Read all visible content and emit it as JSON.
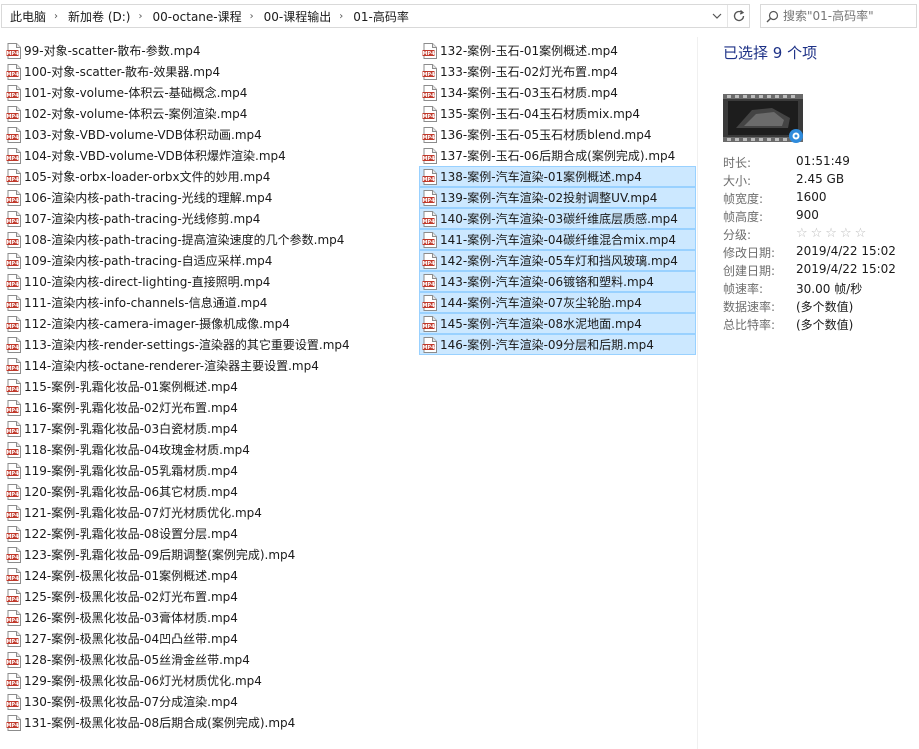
{
  "address": {
    "breadcrumbs": [
      "此电脑",
      "新加卷 (D:)",
      "00-octane-课程",
      "00-课程输出",
      "01-高码率"
    ]
  },
  "search": {
    "placeholder": "搜索\"01-高码率\""
  },
  "files_col1": [
    "99-对象-scatter-散布-参数.mp4",
    "100-对象-scatter-散布-效果器.mp4",
    "101-对象-volume-体积云-基础概念.mp4",
    "102-对象-volume-体积云-案例渲染.mp4",
    "103-对象-VBD-volume-VDB体积动画.mp4",
    "104-对象-VBD-volume-VDB体积爆炸渲染.mp4",
    "105-对象-orbx-loader-orbx文件的妙用.mp4",
    "106-渲染内核-path-tracing-光线的理解.mp4",
    "107-渲染内核-path-tracing-光线修剪.mp4",
    "108-渲染内核-path-tracing-提高渲染速度的几个参数.mp4",
    "109-渲染内核-path-tracing-自适应采样.mp4",
    "110-渲染内核-direct-lighting-直接照明.mp4",
    "111-渲染内核-info-channels-信息通道.mp4",
    "112-渲染内核-camera-imager-摄像机成像.mp4",
    "113-渲染内核-render-settings-渲染器的其它重要设置.mp4",
    "114-渲染内核-octane-renderer-渲染器主要设置.mp4",
    "115-案例-乳霜化妆品-01案例概述.mp4",
    "116-案例-乳霜化妆品-02灯光布置.mp4",
    "117-案例-乳霜化妆品-03白瓷材质.mp4",
    "118-案例-乳霜化妆品-04玫瑰金材质.mp4",
    "119-案例-乳霜化妆品-05乳霜材质.mp4",
    "120-案例-乳霜化妆品-06其它材质.mp4",
    "121-案例-乳霜化妆品-07灯光材质优化.mp4",
    "122-案例-乳霜化妆品-08设置分层.mp4",
    "123-案例-乳霜化妆品-09后期调整(案例完成).mp4",
    "124-案例-极黑化妆品-01案例概述.mp4",
    "125-案例-极黑化妆品-02灯光布置.mp4",
    "126-案例-极黑化妆品-03膏体材质.mp4",
    "127-案例-极黑化妆品-04凹凸丝带.mp4",
    "128-案例-极黑化妆品-05丝滑金丝带.mp4",
    "129-案例-极黑化妆品-06灯光材质优化.mp4",
    "130-案例-极黑化妆品-07分成渲染.mp4",
    "131-案例-极黑化妆品-08后期合成(案例完成).mp4"
  ],
  "files_col2": [
    {
      "name": "132-案例-玉石-01案例概述.mp4",
      "selected": false
    },
    {
      "name": "133-案例-玉石-02灯光布置.mp4",
      "selected": false
    },
    {
      "name": "134-案例-玉石-03玉石材质.mp4",
      "selected": false
    },
    {
      "name": "135-案例-玉石-04玉石材质mix.mp4",
      "selected": false
    },
    {
      "name": "136-案例-玉石-05玉石材质blend.mp4",
      "selected": false
    },
    {
      "name": "137-案例-玉石-06后期合成(案例完成).mp4",
      "selected": false
    },
    {
      "name": "138-案例-汽车渲染-01案例概述.mp4",
      "selected": true
    },
    {
      "name": "139-案例-汽车渲染-02投射调整UV.mp4",
      "selected": true
    },
    {
      "name": "140-案例-汽车渲染-03碳纤维底层质感.mp4",
      "selected": true
    },
    {
      "name": "141-案例-汽车渲染-04碳纤维混合mix.mp4",
      "selected": true
    },
    {
      "name": "142-案例-汽车渲染-05车灯和挡风玻璃.mp4",
      "selected": true
    },
    {
      "name": "143-案例-汽车渲染-06镀铬和塑料.mp4",
      "selected": true
    },
    {
      "name": "144-案例-汽车渲染-07灰尘轮胎.mp4",
      "selected": true
    },
    {
      "name": "145-案例-汽车渲染-08水泥地面.mp4",
      "selected": true
    },
    {
      "name": "146-案例-汽车渲染-09分层和后期.mp4",
      "selected": true
    }
  ],
  "file_icon_label": "MP4",
  "details": {
    "title": "已选择 9 个项",
    "properties": [
      {
        "label": "时长:",
        "value": "01:51:49"
      },
      {
        "label": "大小:",
        "value": "2.45 GB"
      },
      {
        "label": "帧宽度:",
        "value": "1600"
      },
      {
        "label": "帧高度:",
        "value": "900"
      },
      {
        "label": "分级:",
        "value": "☆☆☆☆☆"
      },
      {
        "label": "修改日期:",
        "value": "2019/4/22 15:02"
      },
      {
        "label": "创建日期:",
        "value": "2019/4/22 15:02"
      },
      {
        "label": "帧速率:",
        "value": "30.00 帧/秒"
      },
      {
        "label": "数据速率:",
        "value": "(多个数值)"
      },
      {
        "label": "总比特率:",
        "value": "(多个数值)"
      }
    ]
  },
  "colors": {
    "selection_bg": "#cce8ff",
    "selection_border": "#99d1ff",
    "title_blue": "#1e3287"
  },
  "icons": {
    "file": "mp4-file-icon",
    "search": "search-icon",
    "refresh": "refresh-icon",
    "dropdown": "chevron-down-icon",
    "separator": "chevron-right-icon",
    "thumbnail": "video-thumbnail-icon"
  }
}
